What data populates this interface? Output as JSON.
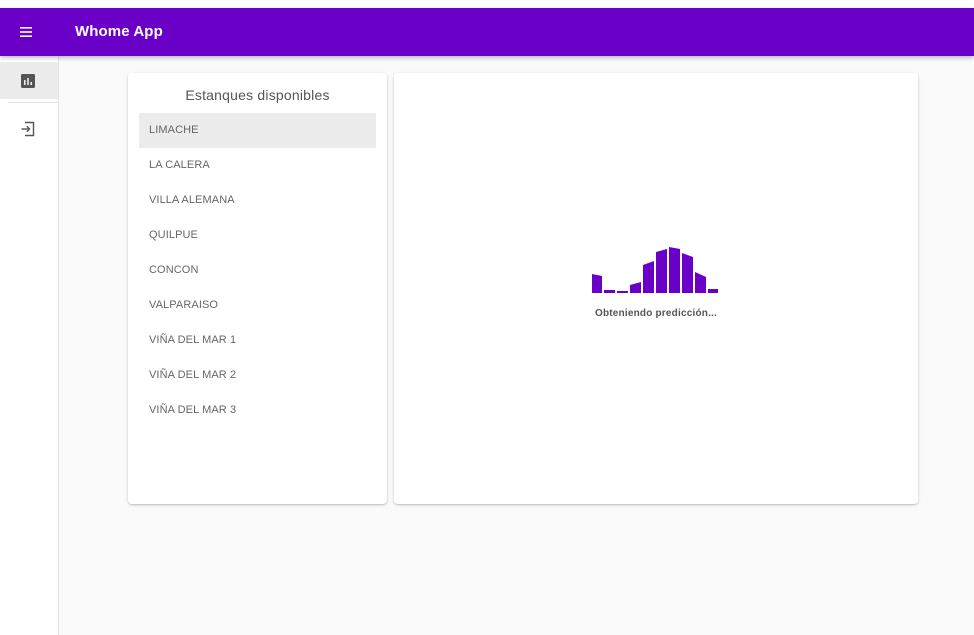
{
  "app": {
    "title": "Whome App",
    "accent_color": "#6a00c8"
  },
  "topbar": {
    "menu_icon": "menu-icon"
  },
  "drawer": {
    "items": [
      {
        "icon": "bar-chart-icon",
        "active": true
      },
      {
        "icon": "login-icon",
        "active": false
      }
    ]
  },
  "tanks": {
    "title": "Estanques disponibles",
    "selected": "LIMACHE",
    "items": [
      "LIMACHE",
      "LA CALERA",
      "VILLA ALEMANA",
      "QUILPUE",
      "CONCON",
      "VALPARAISO",
      "VIÑA DEL MAR 1",
      "VIÑA DEL MAR 2",
      "VIÑA DEL MAR 3"
    ]
  },
  "prediction": {
    "loader_icon": "loading-bars-icon",
    "loading_text": "Obteniendo predicción..."
  }
}
